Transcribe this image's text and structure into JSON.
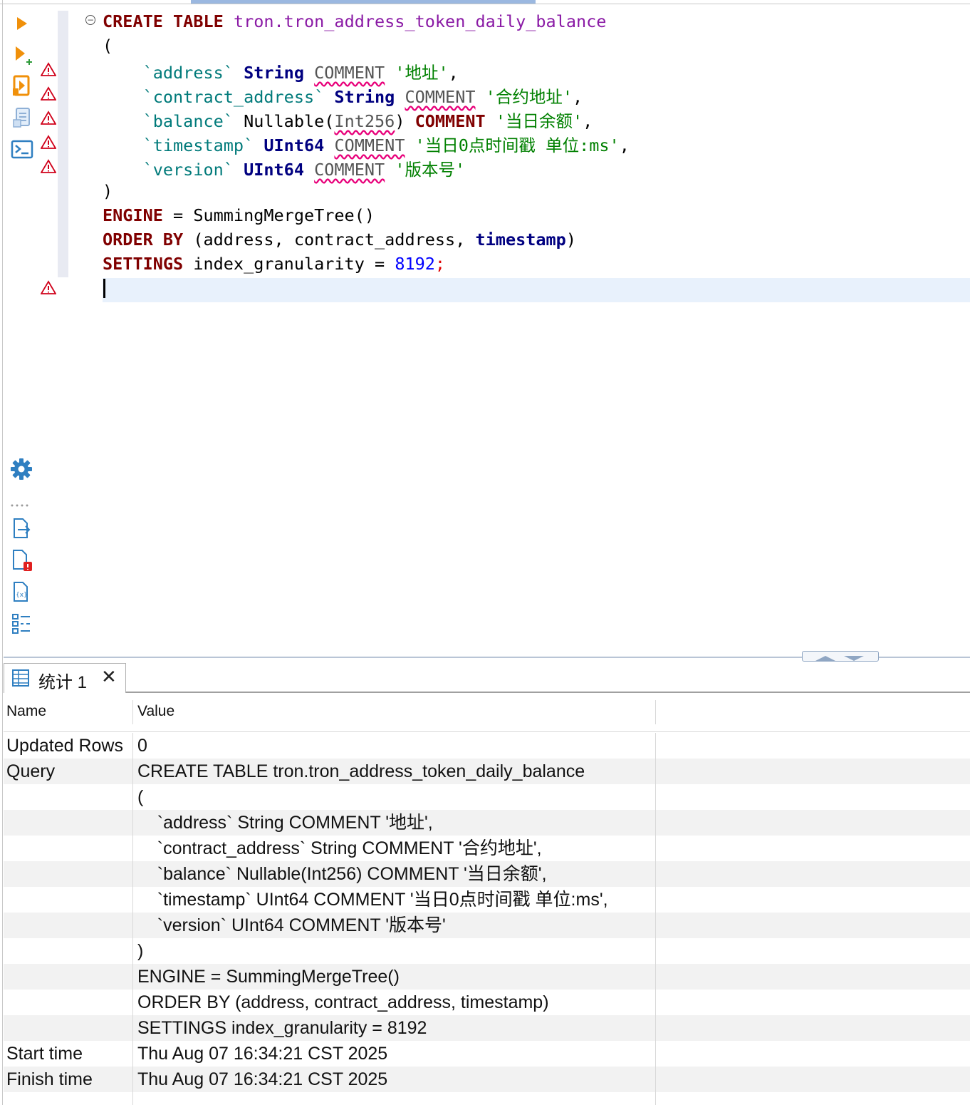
{
  "editor": {
    "code_lines": [
      [
        {
          "t": "CREATE TABLE ",
          "c": "kw"
        },
        {
          "t": "tron.tron_address_token_daily_balance",
          "c": "ident"
        }
      ],
      [
        {
          "t": "(",
          "c": ""
        }
      ],
      [
        {
          "t": "    ",
          "c": ""
        },
        {
          "t": "`address`",
          "c": "bq"
        },
        {
          "t": " ",
          "c": ""
        },
        {
          "t": "String",
          "c": "typ"
        },
        {
          "t": " ",
          "c": ""
        },
        {
          "t": "COMMENT",
          "c": "squig"
        },
        {
          "t": " ",
          "c": ""
        },
        {
          "t": "'地址'",
          "c": "str"
        },
        {
          "t": ",",
          "c": ""
        }
      ],
      [
        {
          "t": "    ",
          "c": ""
        },
        {
          "t": "`contract_address`",
          "c": "bq"
        },
        {
          "t": " ",
          "c": ""
        },
        {
          "t": "String",
          "c": "typ"
        },
        {
          "t": " ",
          "c": ""
        },
        {
          "t": "COMMENT",
          "c": "squig"
        },
        {
          "t": " ",
          "c": ""
        },
        {
          "t": "'合约地址'",
          "c": "str"
        },
        {
          "t": ",",
          "c": ""
        }
      ],
      [
        {
          "t": "    ",
          "c": ""
        },
        {
          "t": "`balance`",
          "c": "bq"
        },
        {
          "t": " Nullable(",
          "c": ""
        },
        {
          "t": "Int256",
          "c": "squig"
        },
        {
          "t": ") ",
          "c": ""
        },
        {
          "t": "COMMENT",
          "c": "kw"
        },
        {
          "t": " ",
          "c": ""
        },
        {
          "t": "'当日余额'",
          "c": "str"
        },
        {
          "t": ",",
          "c": ""
        }
      ],
      [
        {
          "t": "    ",
          "c": ""
        },
        {
          "t": "`timestamp`",
          "c": "bq"
        },
        {
          "t": " ",
          "c": ""
        },
        {
          "t": "UInt64",
          "c": "typ"
        },
        {
          "t": " ",
          "c": ""
        },
        {
          "t": "COMMENT",
          "c": "squig"
        },
        {
          "t": " ",
          "c": ""
        },
        {
          "t": "'当日0点时间戳 单位:ms'",
          "c": "str"
        },
        {
          "t": ",",
          "c": ""
        }
      ],
      [
        {
          "t": "    ",
          "c": ""
        },
        {
          "t": "`version`",
          "c": "bq"
        },
        {
          "t": " ",
          "c": ""
        },
        {
          "t": "UInt64",
          "c": "typ"
        },
        {
          "t": " ",
          "c": ""
        },
        {
          "t": "COMMENT",
          "c": "squig"
        },
        {
          "t": " ",
          "c": ""
        },
        {
          "t": "'版本号'",
          "c": "str"
        }
      ],
      [
        {
          "t": ")",
          "c": ""
        }
      ],
      [
        {
          "t": "ENGINE",
          "c": "kw"
        },
        {
          "t": " = SummingMergeTree()",
          "c": ""
        }
      ],
      [
        {
          "t": "ORDER BY",
          "c": "kw"
        },
        {
          "t": " (address, contract_address, ",
          "c": ""
        },
        {
          "t": "timestamp",
          "c": "typ"
        },
        {
          "t": ")",
          "c": ""
        }
      ],
      [
        {
          "t": "SETTINGS",
          "c": "kw"
        },
        {
          "t": " index_granularity = ",
          "c": ""
        },
        {
          "t": "8192",
          "c": "num"
        },
        {
          "t": ";",
          "c": "semi"
        }
      ]
    ]
  },
  "results_tab": {
    "label": "统计 1"
  },
  "results_table": {
    "headers": {
      "name": "Name",
      "value": "Value"
    },
    "rows": [
      {
        "name": "Updated Rows",
        "value": "0"
      },
      {
        "name": "Query",
        "value": "CREATE TABLE tron.tron_address_token_daily_balance"
      },
      {
        "name": "",
        "value": "("
      },
      {
        "name": "",
        "value": "    `address` String COMMENT '地址',"
      },
      {
        "name": "",
        "value": "    `contract_address` String COMMENT '合约地址',"
      },
      {
        "name": "",
        "value": "    `balance` Nullable(Int256) COMMENT '当日余额',"
      },
      {
        "name": "",
        "value": "    `timestamp` UInt64 COMMENT '当日0点时间戳 单位:ms',"
      },
      {
        "name": "",
        "value": "    `version` UInt64 COMMENT '版本号'"
      },
      {
        "name": "",
        "value": ")"
      },
      {
        "name": "",
        "value": "ENGINE = SummingMergeTree()"
      },
      {
        "name": "",
        "value": "ORDER BY (address, contract_address, timestamp)"
      },
      {
        "name": "",
        "value": "SETTINGS index_granularity = 8192"
      },
      {
        "name": "Start time",
        "value": "Thu Aug 07 16:34:21 CST 2025"
      },
      {
        "name": "Finish time",
        "value": "Thu Aug 07 16:34:21 CST 2025"
      }
    ]
  },
  "colors": {
    "keyword": "#800000",
    "identifier": "#8a1aa5",
    "string": "#008000",
    "type": "#000080",
    "warning": "#d0021b",
    "accent": "#2f7fc1",
    "run": "#f0900a"
  },
  "icons": [
    "run-statement-icon",
    "run-script-icon",
    "explain-plan-icon",
    "load-execution-plan-icon",
    "open-terminal-icon",
    "settings-gear-icon",
    "export-icon",
    "error-log-icon",
    "variables-icon",
    "outline-icon",
    "warning-icon",
    "table-icon",
    "close-icon",
    "fold-toggle-icon"
  ]
}
